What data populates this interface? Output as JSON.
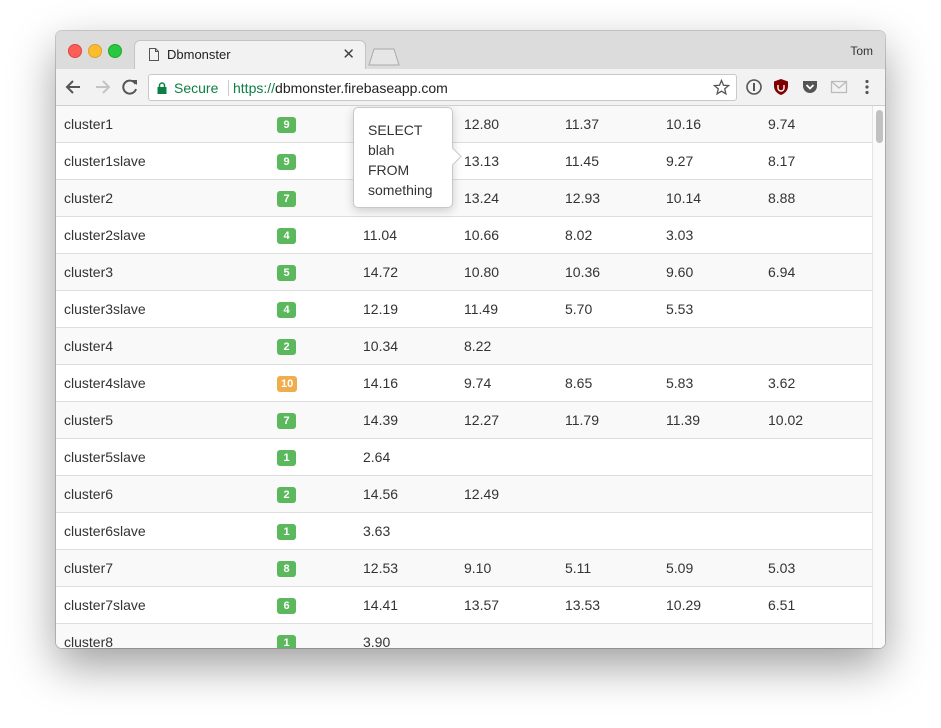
{
  "browser": {
    "tab_title": "Dbmonster",
    "profile_name": "Tom",
    "secure_label": "Secure",
    "url_scheme": "https://",
    "url_host": "dbmonster.firebaseapp.com"
  },
  "tooltip": {
    "text": "SELECT\nblah\nFROM\nsomething"
  },
  "colors": {
    "badge_green": "#5cb85c",
    "badge_orange": "#f0ad4e",
    "secure_green": "#0b8043"
  },
  "rows": [
    {
      "name": "cluster1",
      "count": "9",
      "level": "green",
      "queries": [
        "",
        "12.80",
        "11.37",
        "10.16",
        "9.74"
      ]
    },
    {
      "name": "cluster1slave",
      "count": "9",
      "level": "green",
      "queries": [
        "",
        "13.13",
        "11.45",
        "9.27",
        "8.17"
      ]
    },
    {
      "name": "cluster2",
      "count": "7",
      "level": "green",
      "queries": [
        "",
        "13.24",
        "12.93",
        "10.14",
        "8.88"
      ]
    },
    {
      "name": "cluster2slave",
      "count": "4",
      "level": "green",
      "queries": [
        "11.04",
        "10.66",
        "8.02",
        "3.03",
        ""
      ]
    },
    {
      "name": "cluster3",
      "count": "5",
      "level": "green",
      "queries": [
        "14.72",
        "10.80",
        "10.36",
        "9.60",
        "6.94"
      ]
    },
    {
      "name": "cluster3slave",
      "count": "4",
      "level": "green",
      "queries": [
        "12.19",
        "11.49",
        "5.70",
        "5.53",
        ""
      ]
    },
    {
      "name": "cluster4",
      "count": "2",
      "level": "green",
      "queries": [
        "10.34",
        "8.22",
        "",
        "",
        ""
      ]
    },
    {
      "name": "cluster4slave",
      "count": "10",
      "level": "orange",
      "queries": [
        "14.16",
        "9.74",
        "8.65",
        "5.83",
        "3.62"
      ]
    },
    {
      "name": "cluster5",
      "count": "7",
      "level": "green",
      "queries": [
        "14.39",
        "12.27",
        "11.79",
        "11.39",
        "10.02"
      ]
    },
    {
      "name": "cluster5slave",
      "count": "1",
      "level": "green",
      "queries": [
        "2.64",
        "",
        "",
        "",
        ""
      ]
    },
    {
      "name": "cluster6",
      "count": "2",
      "level": "green",
      "queries": [
        "14.56",
        "12.49",
        "",
        "",
        ""
      ]
    },
    {
      "name": "cluster6slave",
      "count": "1",
      "level": "green",
      "queries": [
        "3.63",
        "",
        "",
        "",
        ""
      ]
    },
    {
      "name": "cluster7",
      "count": "8",
      "level": "green",
      "queries": [
        "12.53",
        "9.10",
        "5.11",
        "5.09",
        "5.03"
      ]
    },
    {
      "name": "cluster7slave",
      "count": "6",
      "level": "green",
      "queries": [
        "14.41",
        "13.57",
        "13.53",
        "10.29",
        "6.51"
      ]
    },
    {
      "name": "cluster8",
      "count": "1",
      "level": "green",
      "queries": [
        "3.90",
        "",
        "",
        "",
        ""
      ]
    }
  ]
}
